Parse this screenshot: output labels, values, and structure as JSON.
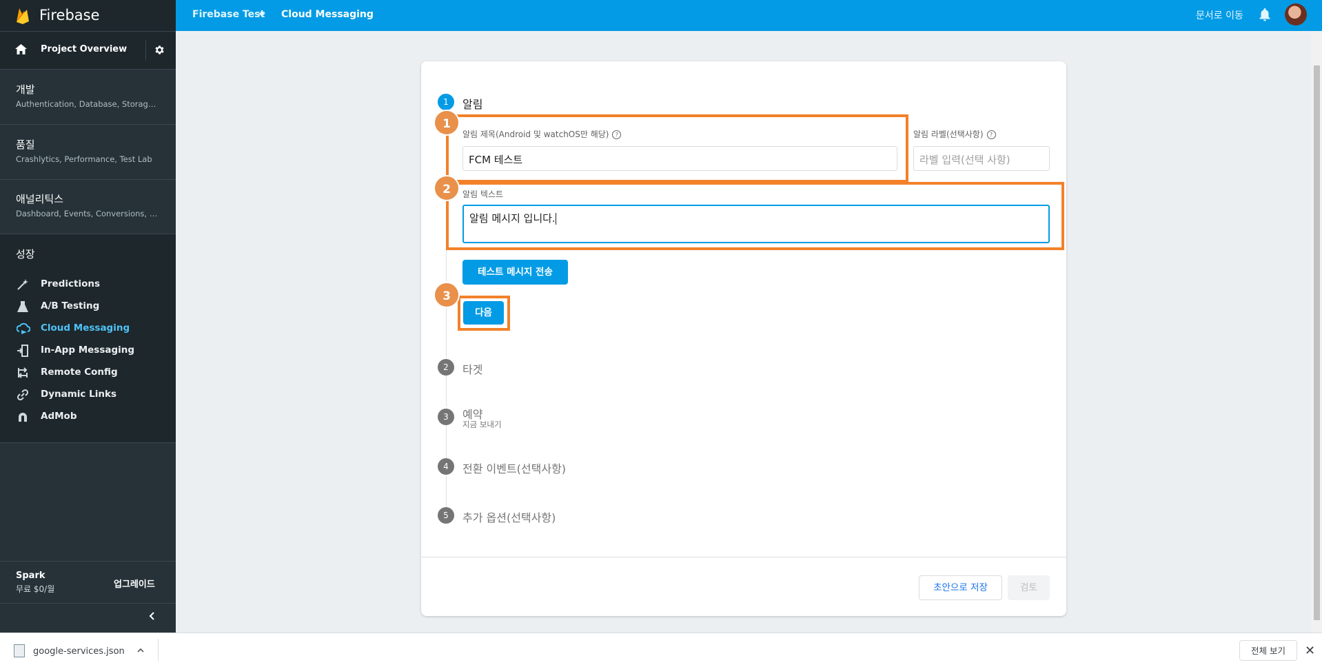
{
  "app": {
    "name": "Firebase"
  },
  "sidebar": {
    "overview": "Project Overview",
    "sections": [
      {
        "title": "개발",
        "subtitle": "Authentication, Database, Storage, ..."
      },
      {
        "title": "품질",
        "subtitle": "Crashlytics, Performance, Test Lab"
      },
      {
        "title": "애널리틱스",
        "subtitle": "Dashboard, Events, Conversions, Au..."
      }
    ],
    "grow_title": "성장",
    "grow_items": [
      {
        "label": "Predictions",
        "icon": "wand-icon"
      },
      {
        "label": "A/B Testing",
        "icon": "flask-icon"
      },
      {
        "label": "Cloud Messaging",
        "icon": "cloud-messaging-icon",
        "active": true
      },
      {
        "label": "In-App Messaging",
        "icon": "in-app-messaging-icon"
      },
      {
        "label": "Remote Config",
        "icon": "remote-config-icon"
      },
      {
        "label": "Dynamic Links",
        "icon": "link-icon"
      },
      {
        "label": "AdMob",
        "icon": "admob-icon"
      }
    ],
    "plan_name": "Spark",
    "plan_price": "무료 $0/월",
    "upgrade": "업그레이드"
  },
  "topbar": {
    "project": "Firebase Test",
    "page": "Cloud Messaging",
    "docs_link": "문서로 이동"
  },
  "steps": [
    {
      "num": "1",
      "title": "알림"
    },
    {
      "num": "2",
      "title": "타겟"
    },
    {
      "num": "3",
      "title": "예약",
      "subtitle": "지금 보내기"
    },
    {
      "num": "4",
      "title": "전환 이벤트(선택사항)"
    },
    {
      "num": "5",
      "title": "추가 옵션(선택사항)"
    }
  ],
  "form": {
    "title_label": "알림 제목(Android 및 watchOS만 해당)",
    "title_value": "FCM 테스트",
    "label_label": "알림 라벨(선택사항)",
    "label_placeholder": "라벨 입력(선택 사항)",
    "text_label": "알림 텍스트",
    "text_value": "알림 메시지 입니다.",
    "test_button": "테스트 메시지 전송",
    "next_button": "다음"
  },
  "footer": {
    "save_draft": "초안으로 저장",
    "review": "검토"
  },
  "annotations": [
    "1",
    "2",
    "3"
  ],
  "download_bar": {
    "file_name": "google-services.json",
    "show_all": "전체 보기"
  },
  "colors": {
    "topbar": "#039be5",
    "sidebar": "#263238",
    "highlight": "#f2812a",
    "active_nav": "#4fc3f7"
  }
}
